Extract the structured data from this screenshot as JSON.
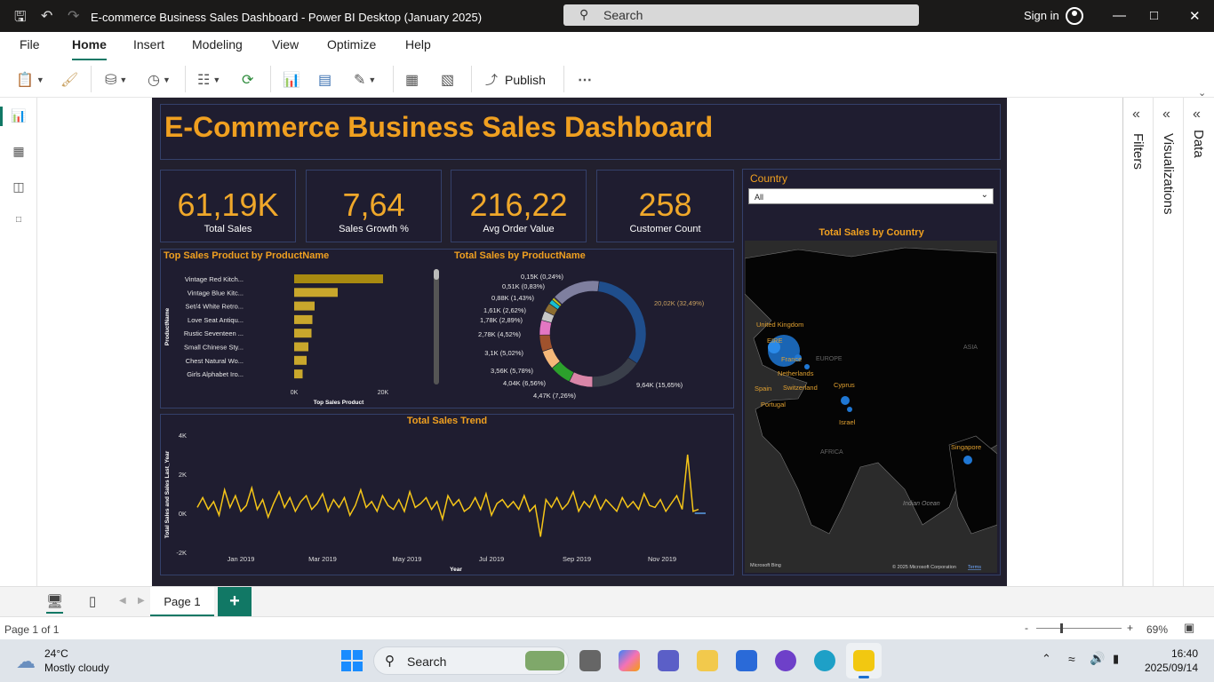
{
  "window": {
    "title": "E-commerce Business Sales Dashboard - Power BI Desktop (January 2025)",
    "search_label": "Search",
    "signin_label": "Sign in"
  },
  "menu": [
    "File",
    "Home",
    "Insert",
    "Modeling",
    "View",
    "Optimize",
    "Help"
  ],
  "ribbon": {
    "publish_label": "Publish",
    "more_label": "⋯"
  },
  "dashboard": {
    "title": "E-Commerce Business Sales Dashboard",
    "kpis": [
      {
        "value": "61,19K",
        "label": "Total Sales"
      },
      {
        "value": "7,64",
        "label": "Sales Growth %"
      },
      {
        "value": "216,22",
        "label": "Avg Order Value"
      },
      {
        "value": "258",
        "label": "Customer Count"
      }
    ],
    "country_filter": {
      "label": "Country",
      "selected": "All"
    }
  },
  "colors": {
    "accent": "#f0a020",
    "bar": "#c9a72c",
    "trend": "#f5c518",
    "map_point": "#1f77d4",
    "donut_main": "#1f4e8c"
  },
  "chart_data": [
    {
      "type": "bar",
      "title": "Top Sales Product by ProductName",
      "categories": [
        "Vintage Red Kitch...",
        "Vintage Blue Kitc...",
        "Set/4 White Retro...",
        "Love Seat Antiqu...",
        "Rustic Seventeen ...",
        "Small Chinese Sty...",
        "Chest Natural Wo...",
        "Girls Alphabet Iro..."
      ],
      "values": [
        20000,
        9800,
        4600,
        4100,
        3900,
        3200,
        2800,
        1900
      ],
      "xlabel": "Top Sales Product",
      "ylabel": "ProductName",
      "xticks": [
        "0K",
        "20K"
      ],
      "xlim": [
        0,
        20000
      ]
    },
    {
      "type": "pie",
      "title": "Total Sales by ProductName",
      "labels": [
        "20,02K (32,49%)",
        "9,64K (15,65%)",
        "4,47K (7,26%)",
        "4,04K (6,56%)",
        "3,56K (5,78%)",
        "3,1K (5,02%)",
        "2,78K (4,52%)",
        "1,78K (2,89%)",
        "1,61K (2,62%)",
        "0,88K (1,43%)",
        "0,51K (0,83%)",
        "0,15K (0,24%)"
      ],
      "values": [
        32.49,
        15.65,
        7.26,
        6.56,
        5.78,
        5.02,
        4.52,
        2.89,
        2.62,
        1.43,
        0.83,
        0.24,
        14.71
      ],
      "colors": [
        "#1f4e8c",
        "#3a3f4a",
        "#d986a8",
        "#2ca02c",
        "#f5b879",
        "#a0522d",
        "#e377c2",
        "#c7c7c7",
        "#8c6d31",
        "#17becf",
        "#bcbd22",
        "#9467bd",
        "#7f7f9f"
      ]
    },
    {
      "type": "line",
      "title": "Total Sales Trend",
      "xlabel": "Year",
      "ylabel": "Total Sales and Sales Last_Year",
      "yticks": [
        "4K",
        "2K",
        "0K",
        "-2K"
      ],
      "ylim": [
        -2000,
        4000
      ],
      "xticks": [
        "Jan 2019",
        "Mar 2019",
        "May 2019",
        "Jul 2019",
        "Sep 2019",
        "Nov 2019"
      ],
      "series": [
        {
          "values": [
            300,
            800,
            200,
            600,
            -100,
            1200,
            300,
            900,
            100,
            400,
            1300,
            200,
            700,
            -200,
            500,
            1100,
            300,
            800,
            100,
            600,
            900,
            200,
            500,
            1000,
            100,
            700,
            300,
            800,
            -100,
            400,
            1200,
            300,
            600,
            100,
            900,
            400,
            200,
            700,
            100,
            1100,
            300,
            500,
            800,
            200,
            600,
            -300,
            900,
            400,
            700,
            100,
            300,
            800,
            200,
            1000,
            -100,
            500,
            700,
            300,
            600,
            200,
            900,
            100,
            400,
            -1200,
            700,
            300,
            800,
            200,
            500,
            1100,
            100,
            600,
            300,
            900,
            200,
            700,
            400,
            100,
            800,
            300,
            600,
            200,
            1000,
            400,
            300,
            700,
            100,
            500,
            900,
            200,
            3000,
            100,
            200
          ]
        },
        {
          "values": [
            0,
            0,
            0,
            0,
            0,
            0,
            0,
            0,
            0,
            0,
            0,
            0,
            0,
            0,
            0,
            0,
            0,
            0,
            0,
            0,
            0,
            0,
            0,
            0,
            0,
            0,
            0,
            0,
            0,
            0,
            0,
            0,
            0,
            0,
            0,
            0,
            0,
            0,
            0,
            0,
            0,
            0,
            0,
            0,
            0,
            0,
            0,
            0,
            0,
            0,
            0,
            0,
            0,
            0,
            0,
            0,
            0,
            0,
            0,
            0,
            0,
            0,
            0,
            0,
            0,
            0,
            0,
            0,
            0,
            0,
            0,
            0,
            0,
            0,
            0,
            0,
            0,
            0,
            0,
            0,
            0,
            0,
            0,
            0,
            0,
            0,
            0,
            0,
            0,
            0,
            0,
            0,
            0,
            500,
            300
          ]
        }
      ]
    }
  ],
  "map": {
    "title": "Total Sales by Country",
    "labels": [
      "United Kingdom",
      "EIRE",
      "France",
      "Netherlands",
      "Spain",
      "Switzerland",
      "Portugal",
      "Cyprus",
      "Israel",
      "Singapore"
    ],
    "regions": [
      "ASIA",
      "EUROPE",
      "AFRICA",
      "Indian Ocean"
    ],
    "footer_left": "Microsoft Bing",
    "footer_right": "© 2025 Microsoft Corporation",
    "footer_terms": "Terms"
  },
  "panes": [
    "Filters",
    "Visualizations",
    "Data"
  ],
  "pages": {
    "active": "Page 1",
    "add": "+"
  },
  "status": {
    "page_info": "Page 1 of 1",
    "zoom": "69%",
    "minus": "-",
    "plus": "+"
  },
  "taskbar": {
    "temp": "24°C",
    "weather": "Mostly cloudy",
    "search": "Search",
    "time": "16:40",
    "date": "2025/09/14"
  }
}
